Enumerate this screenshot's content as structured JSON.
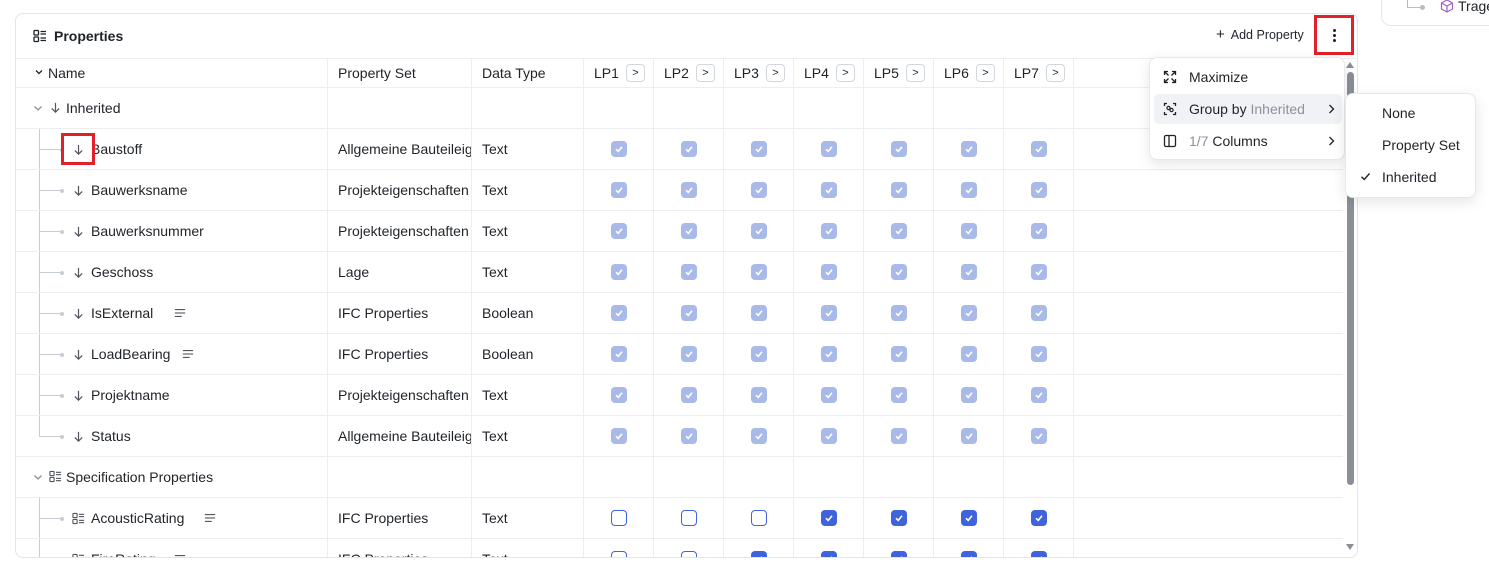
{
  "tree_fragment": {
    "label": "Trage"
  },
  "panel": {
    "title": "Properties",
    "add_property_label": "Add Property",
    "plus_glyph": "+",
    "more_icon": "kebab-menu-icon"
  },
  "columns": {
    "name": "Name",
    "property_set": "Property Set",
    "data_type": "Data Type",
    "lp": [
      "LP1",
      "LP2",
      "LP3",
      "LP4",
      "LP5",
      "LP6",
      "LP7"
    ],
    "lp_arrow": ">"
  },
  "groups": [
    {
      "label": "Inherited",
      "icon": "arrow-down-icon"
    },
    {
      "label": "Specification Properties",
      "icon": "list-grid-icon"
    }
  ],
  "rows": [
    {
      "name": "Baustoff",
      "property_set": "Allgemeine Bauteileigenschaften",
      "data_type": "Text",
      "icon": "arrow-down-icon",
      "has_desc": false,
      "lp": [
        "d",
        "d",
        "d",
        "d",
        "d",
        "d",
        "d"
      ]
    },
    {
      "name": "Bauwerksname",
      "property_set": "Projekteigenschaften",
      "data_type": "Text",
      "icon": "arrow-down-icon",
      "has_desc": false,
      "lp": [
        "d",
        "d",
        "d",
        "d",
        "d",
        "d",
        "d"
      ]
    },
    {
      "name": "Bauwerksnummer",
      "property_set": "Projekteigenschaften",
      "data_type": "Text",
      "icon": "arrow-down-icon",
      "has_desc": false,
      "lp": [
        "d",
        "d",
        "d",
        "d",
        "d",
        "d",
        "d"
      ]
    },
    {
      "name": "Geschoss",
      "property_set": "Lage",
      "data_type": "Text",
      "icon": "arrow-down-icon",
      "has_desc": false,
      "lp": [
        "d",
        "d",
        "d",
        "d",
        "d",
        "d",
        "d"
      ]
    },
    {
      "name": "IsExternal",
      "property_set": "IFC Properties",
      "data_type": "Boolean",
      "icon": "arrow-down-icon",
      "has_desc": true,
      "lp": [
        "d",
        "d",
        "d",
        "d",
        "d",
        "d",
        "d"
      ]
    },
    {
      "name": "LoadBearing",
      "property_set": "IFC Properties",
      "data_type": "Boolean",
      "icon": "arrow-down-icon",
      "has_desc": true,
      "lp": [
        "d",
        "d",
        "d",
        "d",
        "d",
        "d",
        "d"
      ]
    },
    {
      "name": "Projektname",
      "property_set": "Projekteigenschaften",
      "data_type": "Text",
      "icon": "arrow-down-icon",
      "has_desc": false,
      "lp": [
        "d",
        "d",
        "d",
        "d",
        "d",
        "d",
        "d"
      ]
    },
    {
      "name": "Status",
      "property_set": "Allgemeine Bauteileigenschaften",
      "data_type": "Text",
      "icon": "arrow-down-icon",
      "has_desc": false,
      "lp": [
        "d",
        "d",
        "d",
        "d",
        "d",
        "d",
        "d"
      ]
    },
    {
      "name": "AcousticRating",
      "property_set": "IFC Properties",
      "data_type": "Text",
      "icon": "list-grid-icon",
      "has_desc": true,
      "lp": [
        "u",
        "u",
        "u",
        "c",
        "c",
        "c",
        "c"
      ]
    },
    {
      "name": "FireRating",
      "property_set": "IFC Properties",
      "data_type": "Text",
      "icon": "list-grid-icon",
      "has_desc": true,
      "lp": [
        "u",
        "u",
        "c",
        "c",
        "c",
        "c",
        "c"
      ]
    }
  ],
  "menu": {
    "maximize": "Maximize",
    "group_by_prefix": "Group by",
    "group_by_value": "Inherited",
    "columns_count": "1/7",
    "columns_label": "Columns"
  },
  "group_submenu": {
    "options": [
      "None",
      "Property Set",
      "Inherited"
    ],
    "selected": "Inherited"
  },
  "colors": {
    "accent": "#3e63dd",
    "checkbox_disabled": "#a9b9e8",
    "highlight": "#e0202a"
  }
}
